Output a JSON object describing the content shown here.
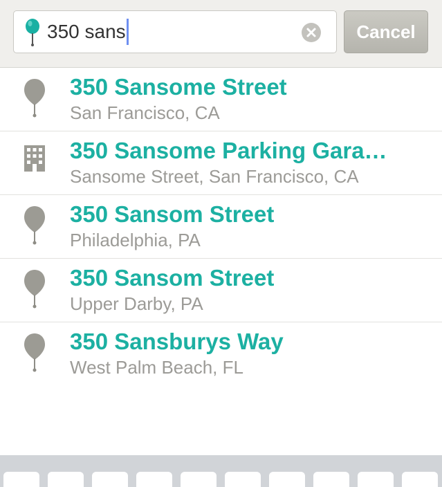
{
  "search": {
    "query": "350 sans",
    "cancel_label": "Cancel",
    "colors": {
      "accent": "#1cb0a2",
      "caret": "#6e8ff0",
      "pin_gray": "#9c9b94"
    }
  },
  "results": [
    {
      "icon": "pin-icon",
      "title": "350 Sansome Street",
      "subtitle": "San Francisco, CA"
    },
    {
      "icon": "building-icon",
      "title": "350 Sansome Parking Gara…",
      "subtitle": "Sansome Street, San Francisco, CA"
    },
    {
      "icon": "pin-icon",
      "title": "350 Sansom Street",
      "subtitle": "Philadelphia, PA"
    },
    {
      "icon": "pin-icon",
      "title": "350 Sansom Street",
      "subtitle": "Upper Darby, PA"
    },
    {
      "icon": "pin-icon",
      "title": "350 Sansburys Way",
      "subtitle": "West Palm Beach, FL"
    }
  ]
}
